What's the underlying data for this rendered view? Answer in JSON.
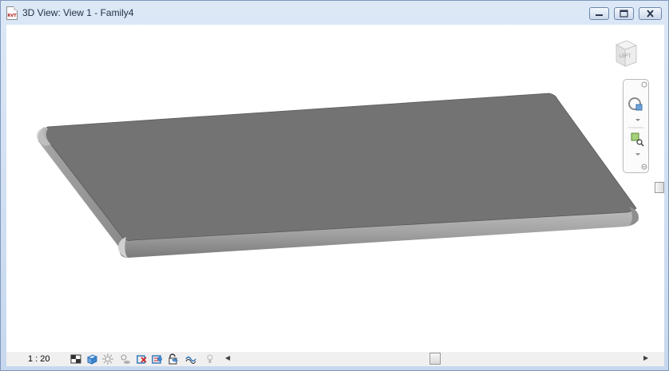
{
  "window": {
    "title": "3D View: View 1 - Family4",
    "app_icon_text": "RVT",
    "buttons": {
      "minimize": "minimize-icon",
      "maximize": "maximize-icon",
      "close": "close-icon"
    }
  },
  "viewcube": {
    "face_label": "LEFT"
  },
  "navigation_bar": {
    "tools": [
      "steering-wheel-icon",
      "zoom-region-icon"
    ],
    "close_icon": "close-icon"
  },
  "status_bar": {
    "scale": "1 : 20",
    "icons": [
      "detail-level-icon",
      "visual-style-icon",
      "sun-path-icon",
      "shadows-icon",
      "crop-view-icon",
      "show-crop-region-icon",
      "unlock-3d-view-icon",
      "temporary-hide-icon",
      "reveal-hidden-icon"
    ]
  },
  "model": {
    "shape": "rounded-slab",
    "top_color": "#737373",
    "edge_color": "#9b9b9b"
  },
  "colors": {
    "titlebar": "#dce8f6",
    "viewport": "#ffffff",
    "status_bar": "#f0f0f0"
  }
}
